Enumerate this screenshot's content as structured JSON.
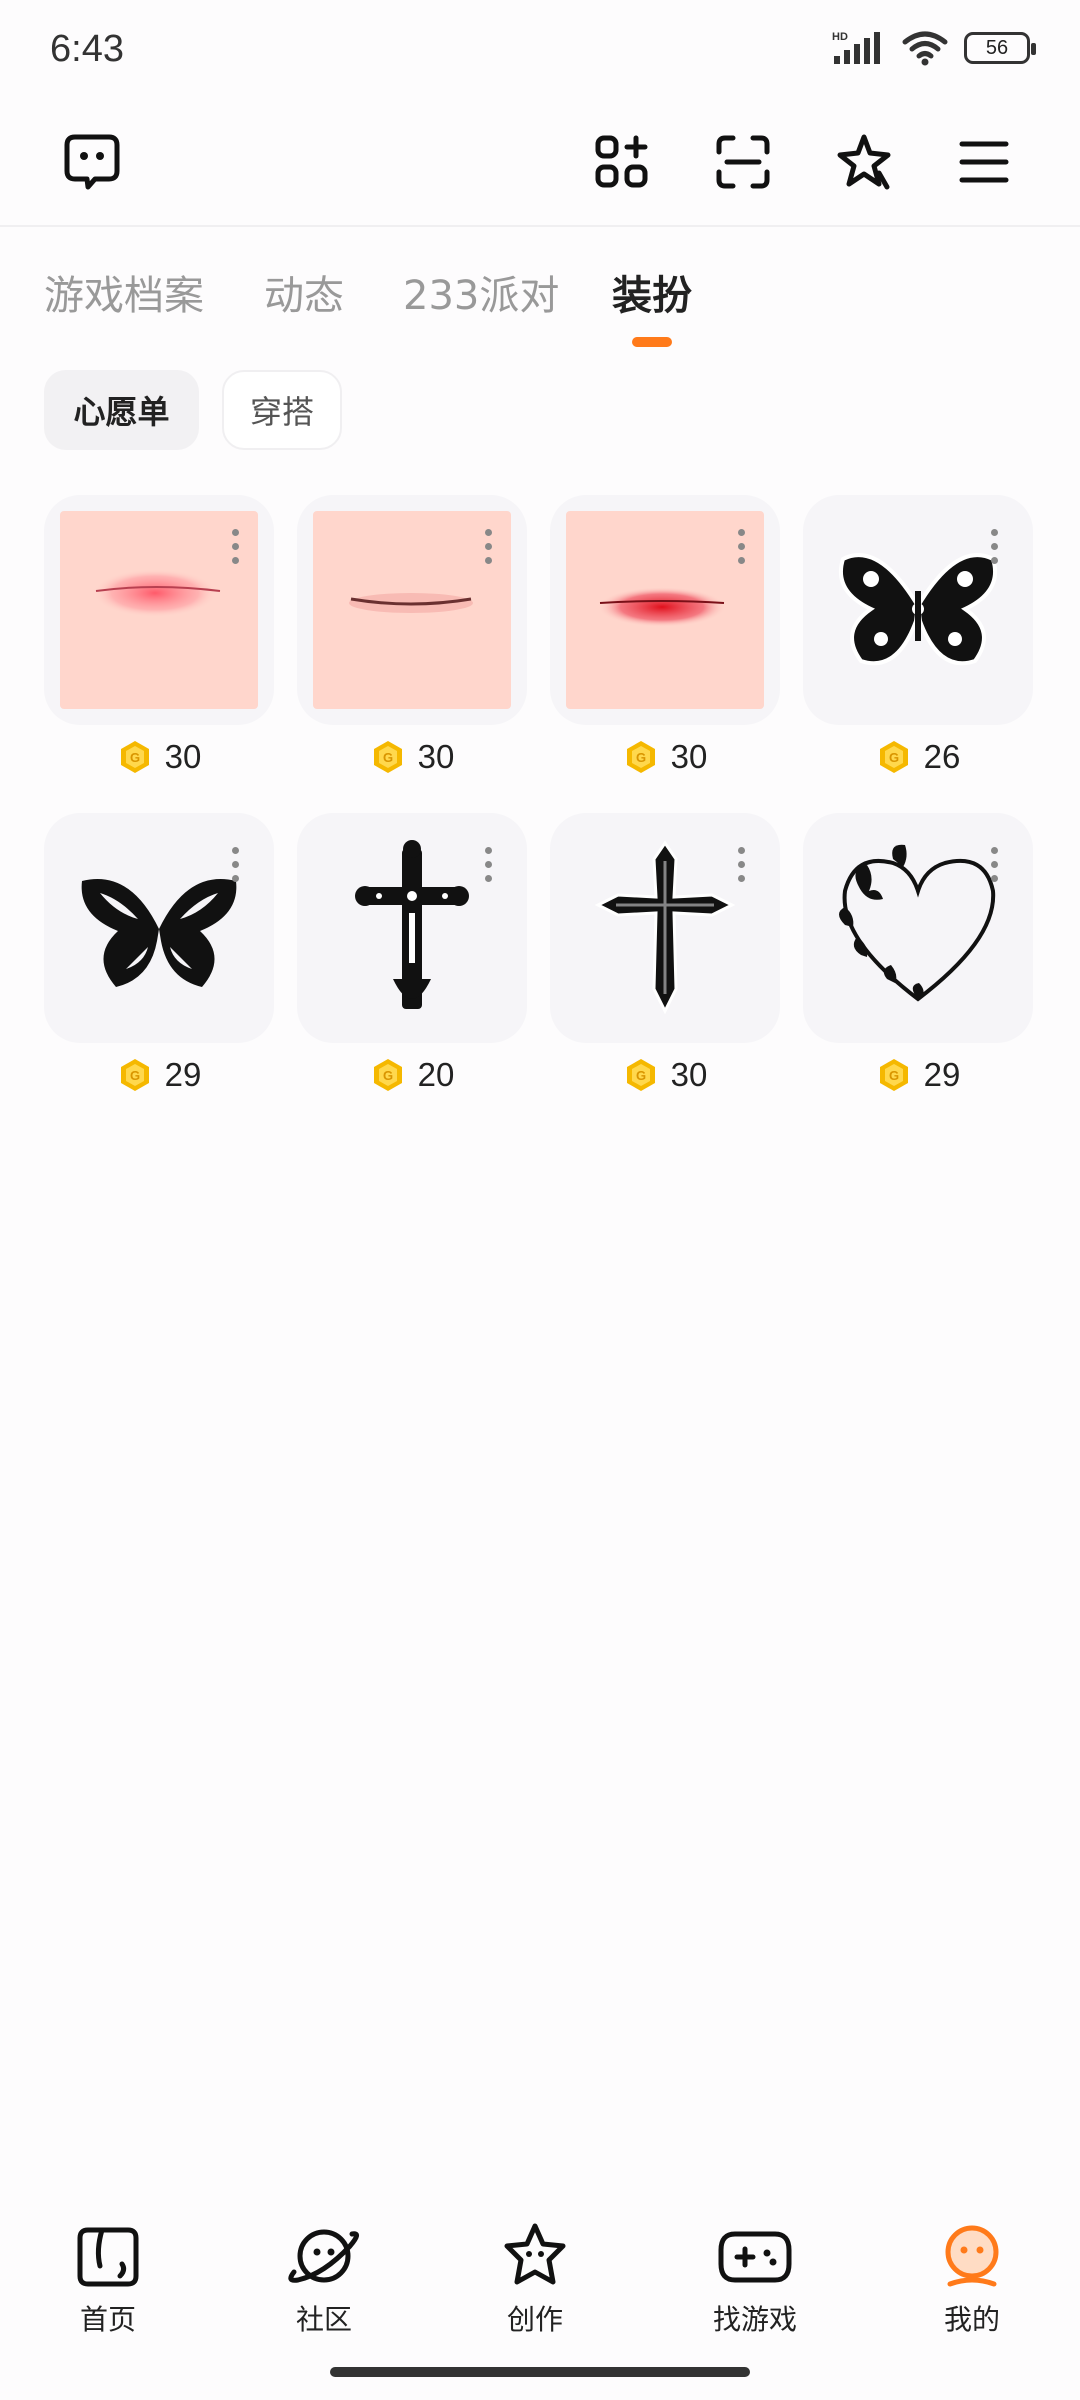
{
  "status_bar": {
    "time": "6:43",
    "network": "HD",
    "battery": "56"
  },
  "tabs": [
    "游戏档案",
    "动态",
    "233派对",
    "装扮"
  ],
  "active_tab": "装扮",
  "chips": {
    "wishlist": "心愿单",
    "outfit": "穿搭"
  },
  "items": [
    {
      "name": "pink-lips-1",
      "price": "30"
    },
    {
      "name": "thin-lips",
      "price": "30"
    },
    {
      "name": "red-lips",
      "price": "30"
    },
    {
      "name": "ornate-butterfly",
      "price": "26"
    },
    {
      "name": "black-butterfly",
      "price": "29"
    },
    {
      "name": "ornate-cross",
      "price": "20"
    },
    {
      "name": "gothic-cross",
      "price": "30"
    },
    {
      "name": "butterfly-heart",
      "price": "29"
    }
  ],
  "bottom_nav": [
    {
      "label": "首页",
      "icon": "home-icon"
    },
    {
      "label": "社区",
      "icon": "planet-icon"
    },
    {
      "label": "创作",
      "icon": "star-face-icon"
    },
    {
      "label": "找游戏",
      "icon": "gamepad-icon"
    },
    {
      "label": "我的",
      "icon": "profile-icon"
    }
  ],
  "colors": {
    "accent": "#ff7a1a",
    "coin": "#f5b800"
  }
}
